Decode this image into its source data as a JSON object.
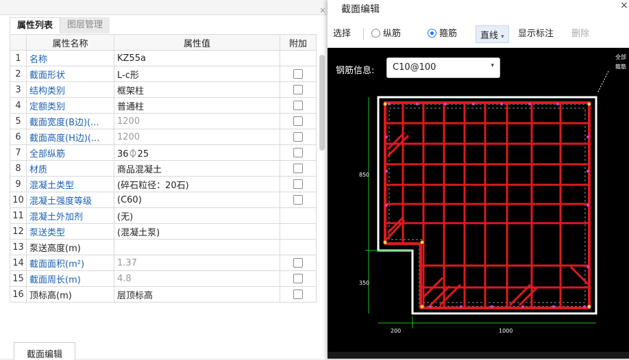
{
  "left_panel": {
    "tabs": [
      {
        "label": "属性列表",
        "active": true
      },
      {
        "label": "图层管理",
        "active": false
      }
    ],
    "columns": {
      "idx": "",
      "name": "属性名称",
      "value": "属性值",
      "extra": "附加"
    },
    "rows": [
      {
        "idx": "1",
        "name": "名称",
        "value": "KZ55a",
        "has_checkbox": false,
        "link": true
      },
      {
        "idx": "2",
        "name": "截面形状",
        "value": "L-c形",
        "has_checkbox": true,
        "link": true
      },
      {
        "idx": "3",
        "name": "结构类别",
        "value": "框架柱",
        "has_checkbox": true,
        "link": true
      },
      {
        "idx": "4",
        "name": "定额类别",
        "value": "普通柱",
        "has_checkbox": true,
        "link": true
      },
      {
        "idx": "5",
        "name": "截面宽度(B边)(...",
        "value": "1200",
        "has_checkbox": true,
        "link": true,
        "gray": true
      },
      {
        "idx": "6",
        "name": "截面高度(H边)(...",
        "value": "1200",
        "has_checkbox": true,
        "link": true,
        "gray": true
      },
      {
        "idx": "7",
        "name": "全部纵筋",
        "value": "36⏀25",
        "has_checkbox": true,
        "link": true
      },
      {
        "idx": "8",
        "name": "材质",
        "value": "商品混凝土",
        "has_checkbox": true,
        "link": true
      },
      {
        "idx": "9",
        "name": "混凝土类型",
        "value": "(碎石粒径：20石)",
        "has_checkbox": true,
        "link": true
      },
      {
        "idx": "10",
        "name": "混凝土强度等级",
        "value": "(C60)",
        "has_checkbox": true,
        "link": true
      },
      {
        "idx": "11",
        "name": "混凝土外加剂",
        "value": "(无)",
        "has_checkbox": false,
        "link": true
      },
      {
        "idx": "12",
        "name": "泵送类型",
        "value": "(混凝土泵)",
        "has_checkbox": false,
        "link": true
      },
      {
        "idx": "13",
        "name": "泵送高度(m)",
        "value": "",
        "has_checkbox": false,
        "link": false
      },
      {
        "idx": "14",
        "name": "截面面积(m²)",
        "value": "1.37",
        "has_checkbox": true,
        "link": true,
        "gray": true
      },
      {
        "idx": "15",
        "name": "截面周长(m)",
        "value": "4.8",
        "has_checkbox": true,
        "link": true,
        "gray": true
      },
      {
        "idx": "16",
        "name": "顶标高(m)",
        "value": "层顶标高",
        "has_checkbox": true,
        "link": false
      }
    ],
    "bottom_button": "截面编辑"
  },
  "dialog": {
    "title": "截面编辑",
    "close": "×",
    "toolbar": {
      "select": "选择",
      "radio_longitudinal": "纵筋",
      "radio_stirrup": "箍筋",
      "stirrup_selected": true,
      "line_mode": "直线",
      "line_arrow": "▾",
      "show_annotation": "显示标注",
      "delete": "删除"
    },
    "rebar_info_label": "钢筋信息:",
    "rebar_info_value": "C10@100",
    "dropdown_arrow": "▾",
    "drawing": {
      "dim_left_upper": "850",
      "dim_left_lower": "350",
      "dim_bottom_left": "200",
      "dim_bottom_right": "1000",
      "corner_note": [
        "全部",
        "箍筋"
      ],
      "stirrup_color": "#e0191f",
      "outline_color": "#ffffff",
      "dimension_color": "#22c422"
    }
  }
}
